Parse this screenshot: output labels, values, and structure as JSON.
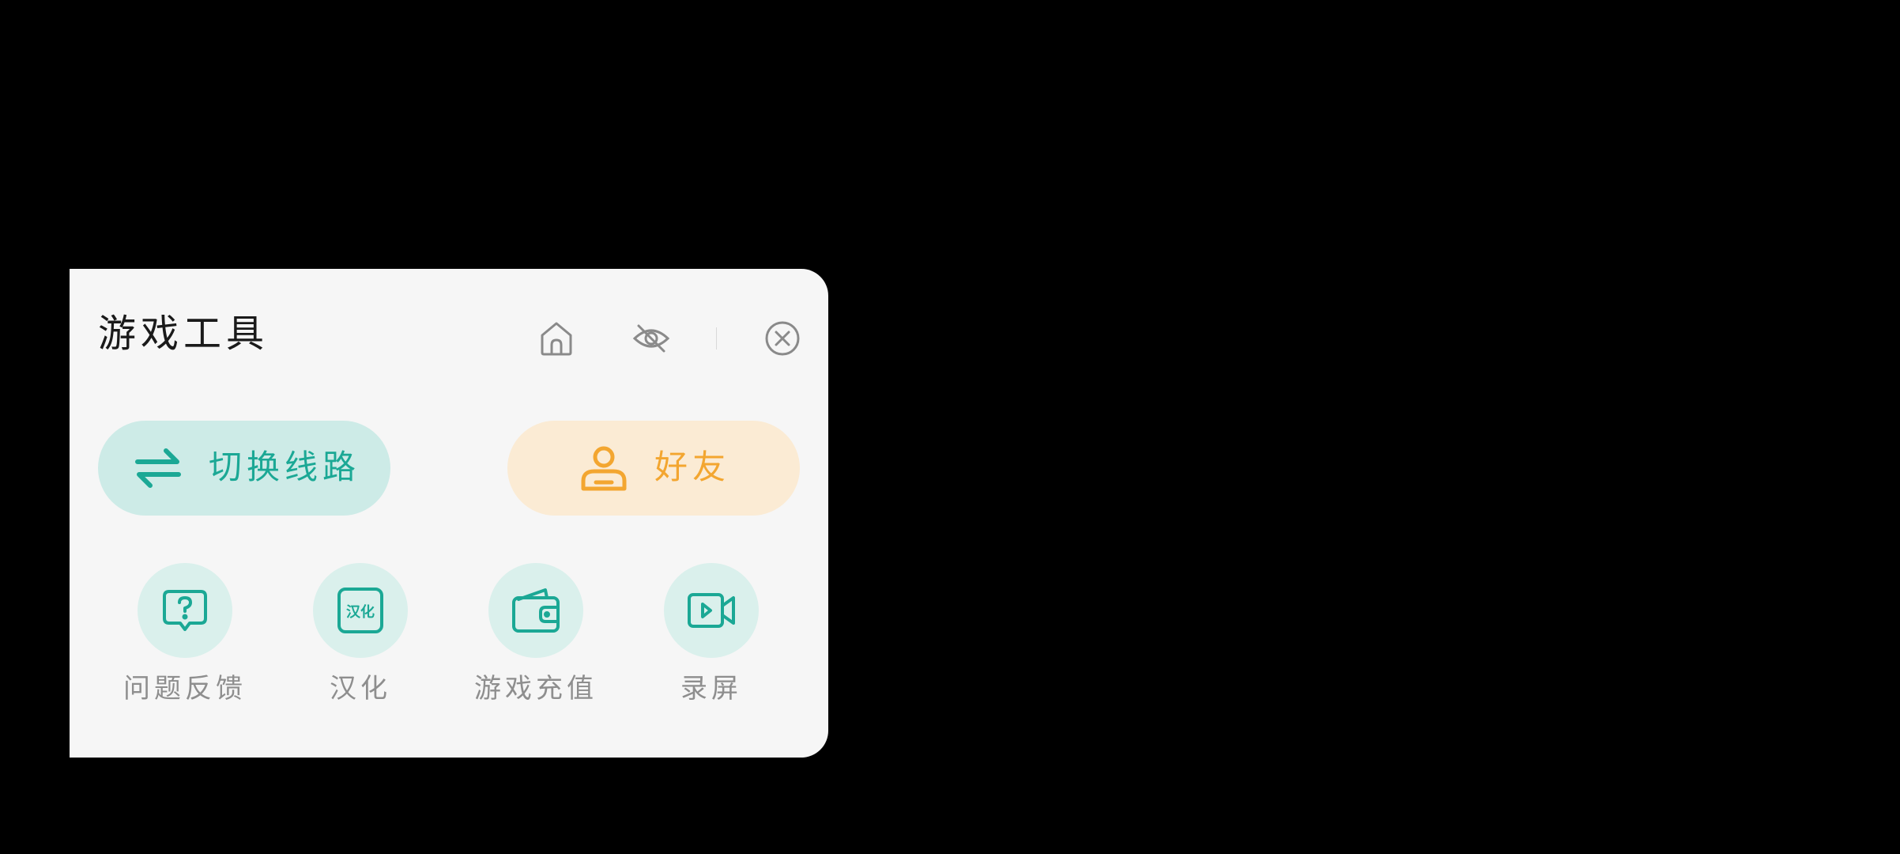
{
  "panel": {
    "title": "游戏工具",
    "header_icons": [
      "home-icon",
      "eye-off-icon",
      "close-circle-icon"
    ]
  },
  "actions": {
    "switch_line": {
      "label": "切换线路",
      "icon": "swap-arrows-icon",
      "color": "#1ba895"
    },
    "friends": {
      "label": "好友",
      "icon": "person-icon",
      "color": "#f3a630"
    }
  },
  "tools": [
    {
      "label": "问题反馈",
      "icon": "feedback-question-icon"
    },
    {
      "label": "汉化",
      "icon": "translate-icon",
      "icon_text": "汉化"
    },
    {
      "label": "游戏充值",
      "icon": "wallet-icon"
    },
    {
      "label": "录屏",
      "icon": "video-record-icon"
    }
  ],
  "colors": {
    "accent": "#1ba895",
    "friend": "#f3a630",
    "panel_bg": "#f6f6f6"
  }
}
